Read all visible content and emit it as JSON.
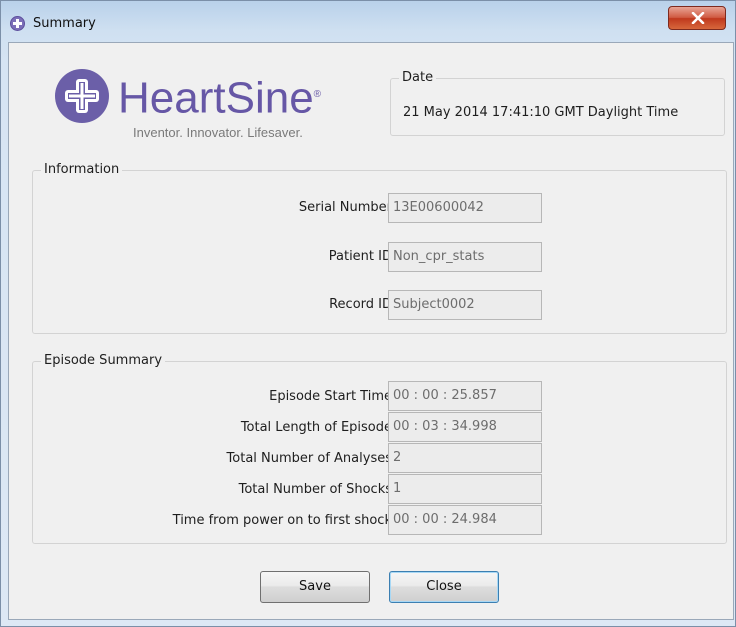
{
  "window": {
    "title": "Summary",
    "icon": "heartsine-app-icon",
    "close_icon": "close-x-icon"
  },
  "logo": {
    "brand": "HeartSine",
    "tagline": "Inventor. Innovator. Lifesaver."
  },
  "date": {
    "legend": "Date",
    "value": "21 May 2014 17:41:10 GMT Daylight Time"
  },
  "information": {
    "legend": "Information",
    "rows": [
      {
        "label": "Serial Number",
        "value": "13E00600042"
      },
      {
        "label": "Patient ID",
        "value": "Non_cpr_stats"
      },
      {
        "label": "Record ID",
        "value": "Subject0002"
      }
    ]
  },
  "episode": {
    "legend": "Episode Summary",
    "rows": [
      {
        "label": "Episode Start Time",
        "value": "00 : 00 : 25.857"
      },
      {
        "label": "Total Length of Episode",
        "value": "00 : 03 : 34.998"
      },
      {
        "label": "Total Number of Analyses",
        "value": "2"
      },
      {
        "label": "Total Number of Shocks",
        "value": "1"
      },
      {
        "label": "Time from power on to first shock",
        "value": "00 : 00 : 24.984"
      }
    ]
  },
  "buttons": {
    "save": "Save",
    "close": "Close"
  },
  "colors": {
    "brand": "#6657a6",
    "close_button": "#c0381d"
  }
}
